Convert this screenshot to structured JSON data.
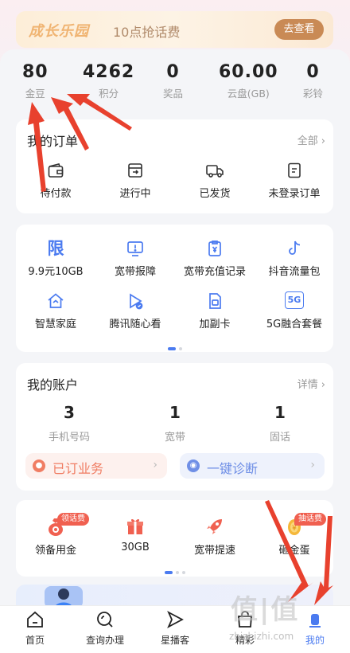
{
  "banner": {
    "brand": "成长乐园",
    "subtitle": "10点抢话费",
    "button": "去查看"
  },
  "stats": [
    {
      "value": "80",
      "label": "金豆"
    },
    {
      "value": "4262",
      "label": "积分"
    },
    {
      "value": "0",
      "label": "奖品"
    },
    {
      "value": "60.00",
      "label": "云盘(GB)"
    },
    {
      "value": "0",
      "label": "彩铃"
    }
  ],
  "orders": {
    "title": "我的订单",
    "more": "全部",
    "items": [
      {
        "label": "待付款",
        "icon": "wallet-icon"
      },
      {
        "label": "进行中",
        "icon": "box-icon"
      },
      {
        "label": "已发货",
        "icon": "truck-icon"
      },
      {
        "label": "未登录订单",
        "icon": "document-icon"
      }
    ]
  },
  "services": {
    "items": [
      {
        "label": "9.9元10GB",
        "icon": "xian-icon",
        "icon_text": "限"
      },
      {
        "label": "宽带报障",
        "icon": "monitor-alert-icon"
      },
      {
        "label": "宽带充值记录",
        "icon": "yuan-clipboard-icon"
      },
      {
        "label": "抖音流量包",
        "icon": "tiktok-icon"
      },
      {
        "label": "智慧家庭",
        "icon": "house-icon"
      },
      {
        "label": "腾讯随心看",
        "icon": "video-play-icon"
      },
      {
        "label": "加副卡",
        "icon": "sim-card-icon"
      },
      {
        "label": "5G融合套餐",
        "icon": "5g-icon",
        "icon_text": "5G"
      }
    ]
  },
  "account": {
    "title": "我的账户",
    "more": "详情",
    "items": [
      {
        "value": "3",
        "label": "手机号码"
      },
      {
        "value": "1",
        "label": "宽带"
      },
      {
        "value": "1",
        "label": "固话"
      }
    ],
    "pill_left": "已订业务",
    "pill_right": "一键诊断"
  },
  "benefits": {
    "items": [
      {
        "label": "领备用金",
        "tag": "领话费",
        "icon": "money-bag-icon"
      },
      {
        "label": "30GB",
        "tag": "",
        "icon": "gift-icon"
      },
      {
        "label": "宽带提速",
        "tag": "",
        "icon": "rocket-icon"
      },
      {
        "label": "砸金蛋",
        "tag": "抽话费",
        "icon": "golden-egg-icon"
      }
    ]
  },
  "tabbar": {
    "items": [
      {
        "label": "首页",
        "icon": "home-icon"
      },
      {
        "label": "查询办理",
        "icon": "search-icon"
      },
      {
        "label": "星播客",
        "icon": "send-icon"
      },
      {
        "label": "精彩",
        "icon": "bag-icon"
      },
      {
        "label": "我的",
        "icon": "person-icon"
      }
    ]
  },
  "watermark": {
    "text": "值|值",
    "sub": "zhizhizhi.com"
  },
  "colors": {
    "accent": "#4b7bf0",
    "arrow": "#e8412e",
    "banner_button": "#c98a55"
  }
}
